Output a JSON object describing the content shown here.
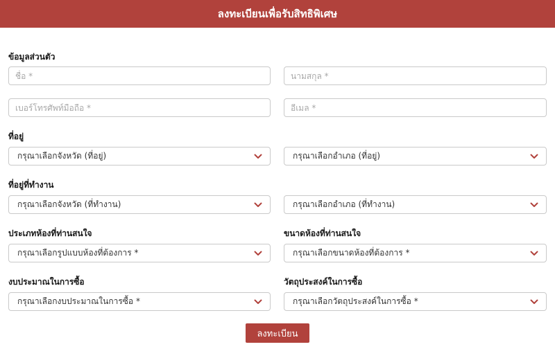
{
  "header": {
    "title": "ลงทะเบียนเพื่อรับสิทธิพิเศษ"
  },
  "personal": {
    "label": "ข้อมูลส่วนตัว",
    "first_name": {
      "placeholder": "ชื่อ *",
      "value": ""
    },
    "last_name": {
      "placeholder": "นามสกุล *",
      "value": ""
    },
    "phone": {
      "placeholder": "เบอร์โทรศัพท์มือถือ *",
      "value": ""
    },
    "email": {
      "placeholder": "อีเมล *",
      "value": ""
    }
  },
  "address": {
    "label": "ที่อยู่",
    "province": "กรุณาเลือกจังหวัด (ที่อยู่)",
    "district": "กรุณาเลือกอำเภอ (ที่อยู่)"
  },
  "work_address": {
    "label": "ที่อยู่ที่ทำงาน",
    "province": "กรุณาเลือกจังหวัด (ที่ทำงาน)",
    "district": "กรุณาเลือกอำเภอ (ที่ทำงาน)"
  },
  "room_type": {
    "label": "ประเภทห้องที่ท่านสนใจ",
    "select": "กรุณาเลือกรูปแบบห้องที่ต้องการ *"
  },
  "room_size": {
    "label": "ขนาดห้องที่ท่านสนใจ",
    "select": "กรุณาเลือกขนาดห้องที่ต้องการ *"
  },
  "budget": {
    "label": "งบประมาณในการซื้อ",
    "select": "กรุณาเลือกงบประมาณในการซื้อ *"
  },
  "purpose": {
    "label": "วัตถุประสงค์ในการซื้อ",
    "select": "กรุณาเลือกวัตถุประสงค์ในการซื้อ *"
  },
  "submit": {
    "label": "ลงทะเบียน"
  },
  "colors": {
    "accent": "#b1423c",
    "border": "#c9c9c9",
    "placeholder": "#a8a8a8"
  },
  "icons": {
    "dropdown": "chevron-down-icon"
  }
}
